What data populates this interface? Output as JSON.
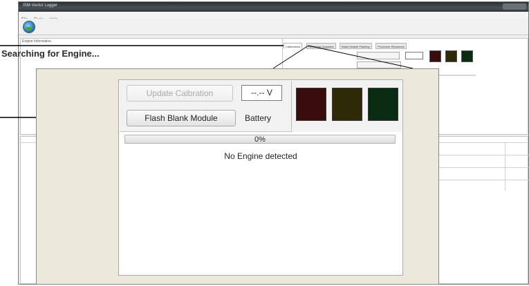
{
  "window": {
    "title": "ISM-Vector Logger",
    "menu": [
      "File",
      "Tools",
      "Help"
    ]
  },
  "main": {
    "status_heading": "Searching for Engine...",
    "panel_tab": "Engine Information"
  },
  "tabs": [
    "Calibrations",
    "Parameter Upgrades",
    "Blank Module Flashing",
    "Procedure Resources"
  ],
  "calibration": {
    "update_button": "Update Calbration",
    "flash_button": "Flash Blank Module",
    "voltage": "--.-- V",
    "battery_label": "Battery",
    "progress_text": "0%",
    "progress": 0,
    "status": "No Engine detected",
    "indicators": [
      {
        "name": "red-indicator",
        "color": "#3a0b0b"
      },
      {
        "name": "yellow-indicator",
        "color": "#2e2a08"
      },
      {
        "name": "green-indicator",
        "color": "#0a2a12"
      }
    ]
  },
  "colors": {
    "callout_bg": "#ece9dc",
    "title_bar": "#3b4147"
  }
}
